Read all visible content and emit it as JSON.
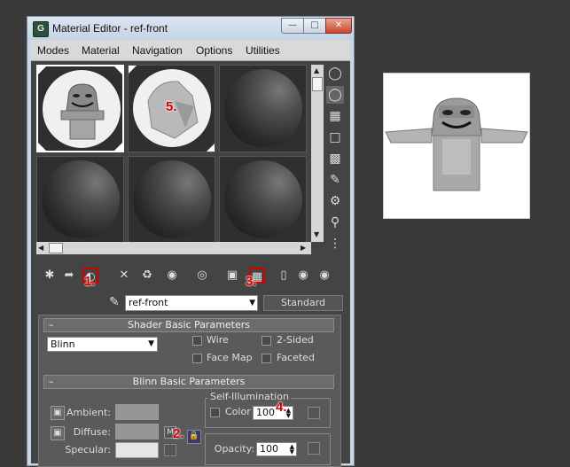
{
  "window": {
    "title": "Material Editor - ref-front",
    "app_icon": "3ds-max-logo-icon"
  },
  "menu": {
    "items": [
      "Modes",
      "Material",
      "Navigation",
      "Options",
      "Utilities"
    ]
  },
  "slots": {
    "count": 6,
    "selected_index": 0,
    "annotation_slot2": "5."
  },
  "toolbar": {
    "annotations": [
      "1.",
      "3."
    ]
  },
  "material": {
    "name": "ref-front",
    "type_button": "Standard"
  },
  "shader_rollout": {
    "title": "Shader Basic Parameters",
    "shader": "Blinn",
    "options": [
      "Wire",
      "2-Sided",
      "Face Map",
      "Faceted"
    ]
  },
  "blinn_rollout": {
    "title": "Blinn Basic Parameters",
    "ambient_label": "Ambient:",
    "diffuse_label": "Diffuse:",
    "specular_label": "Specular:",
    "diffuse_map_label": "M",
    "annotation_diffuse": "2.",
    "self_illum_title": "Self-Illumination",
    "color_label": "Color",
    "color_value": "100",
    "annotation_color": "4.",
    "opacity_label": "Opacity:",
    "opacity_value": "100"
  },
  "colors": {
    "annotation_red": "#d40000",
    "ambient_swatch": "#969696",
    "diffuse_swatch": "#969696",
    "specular_swatch": "#e5e5e5"
  }
}
